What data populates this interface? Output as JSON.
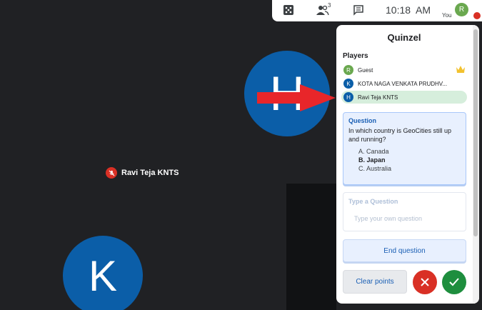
{
  "stage": {
    "participant_name": "Ravi Teja KNTS",
    "tile_h_initial": "H",
    "tile_k_initial": "K"
  },
  "topbar": {
    "icons": [
      "dice-icon",
      "people-icon",
      "chat-icon"
    ],
    "people_count": "3",
    "time": "10:18  AM",
    "self_initial": "R",
    "self_label": "You"
  },
  "panel": {
    "title": "Quinzel",
    "players_label": "Players",
    "players": [
      {
        "initial": "R",
        "name": "Guest",
        "color": "#6aa84f",
        "leader": true,
        "selected": false
      },
      {
        "initial": "K",
        "name": "KOTA NAGA VENKATA PRUDHV...",
        "color": "#0b5ea8",
        "leader": false,
        "selected": false
      },
      {
        "initial": "H",
        "name": "Ravi Teja KNTS",
        "color": "#0b5ea8",
        "leader": false,
        "selected": true
      }
    ],
    "question": {
      "label": "Question",
      "text": "In which country is GeoCities still up and running?",
      "options": [
        {
          "letter": "A.",
          "text": "Canada",
          "correct": false
        },
        {
          "letter": "B.",
          "text": "Japan",
          "correct": true
        },
        {
          "letter": "C.",
          "text": "Australia",
          "correct": false
        }
      ]
    },
    "compose": {
      "label": "Type a Question",
      "placeholder": "Type your own question"
    },
    "end_button": "End question",
    "clear_button": "Clear points"
  },
  "colors": {
    "accent": "#1a5fb4",
    "avatar_blue": "#0b5ea8",
    "danger": "#d93025",
    "success": "#1e8e3e",
    "highlight": "#d6eedc"
  }
}
